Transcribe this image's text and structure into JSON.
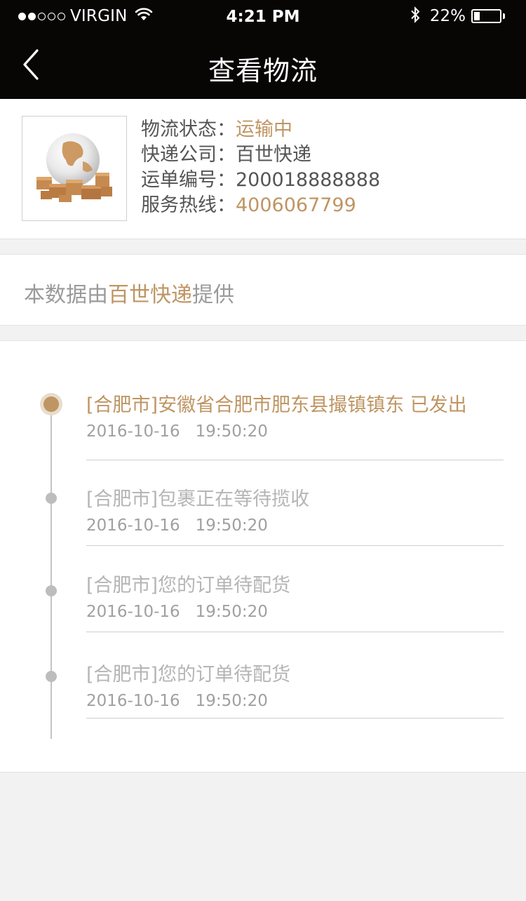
{
  "status_bar": {
    "carrier": "VIRGIN",
    "signal_dots": [
      true,
      true,
      false,
      false,
      false
    ],
    "time": "4:21 PM",
    "battery_percent": "22%",
    "battery_level": 0.22
  },
  "nav": {
    "title": "查看物流",
    "back_icon": "chevron-left-icon"
  },
  "shipment": {
    "status_label": "物流状态：",
    "status_value": "运输中",
    "company_label": "快递公司：",
    "company_value": "百世快递",
    "waybill_label": "运单编号：",
    "waybill_value": "200018888888",
    "hotline_label": "服务热线：",
    "hotline_value": "4006067799"
  },
  "provider": {
    "prefix": "本数据由",
    "name": "百世快递",
    "suffix": "提供"
  },
  "timeline": [
    {
      "text": "[合肥市]安徽省合肥市肥东县撮镇镇东 已发出",
      "time": "2016-10-16   19:50:20",
      "active": true
    },
    {
      "text": "[合肥市]包裹正在等待揽收",
      "time": "2016-10-16   19:50:20",
      "active": false
    },
    {
      "text": "[合肥市]您的订单待配货",
      "time": "2016-10-16   19:50:20",
      "active": false
    },
    {
      "text": "[合肥市]您的订单待配货",
      "time": "2016-10-16   19:50:20",
      "active": false
    }
  ],
  "colors": {
    "accent": "#bf9563",
    "bar_bg": "#080505",
    "muted_text": "#b5b5b5"
  }
}
